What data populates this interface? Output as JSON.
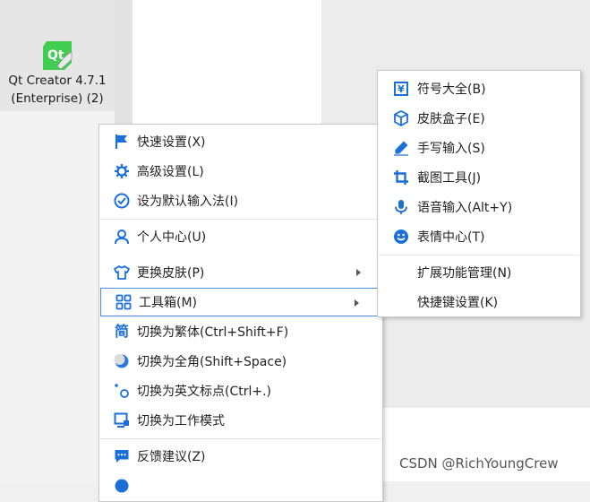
{
  "desktop": {
    "icon_text": "Qt",
    "label_line1": "Qt Creator 4.7.1",
    "label_line2": "(Enterprise) (2)"
  },
  "main_menu": {
    "quick_settings": "快速设置(X)",
    "advanced_settings": "高级设置(L)",
    "set_default_ime": "设为默认输入法(I)",
    "personal_center": "个人中心(U)",
    "change_skin": "更换皮肤(P)",
    "toolbox": "工具箱(M)",
    "switch_traditional": "切换为繁体(Ctrl+Shift+F)",
    "switch_fullwidth": "切换为全角(Shift+Space)",
    "switch_english_punct": "切换为英文标点(Ctrl+.)",
    "switch_work_mode": "切换为工作模式",
    "feedback": "反馈建议(Z)",
    "traditional_icon_glyph": "简"
  },
  "sub_menu": {
    "symbols": "符号大全(B)",
    "skin_box": "皮肤盒子(E)",
    "handwriting": "手写输入(S)",
    "screenshot": "截图工具(J)",
    "voice_input": "语音输入(Alt+Y)",
    "emoji_center": "表情中心(T)",
    "extensions": "扩展功能管理(N)",
    "shortcuts": "快捷键设置(K)",
    "symbols_icon_glyph": "¥"
  },
  "watermark": "CSDN @RichYoungCrew",
  "colors": {
    "accent_blue": "#1a6fd8",
    "highlight_border": "#4a8cde",
    "qt_green": "#41cd52"
  }
}
